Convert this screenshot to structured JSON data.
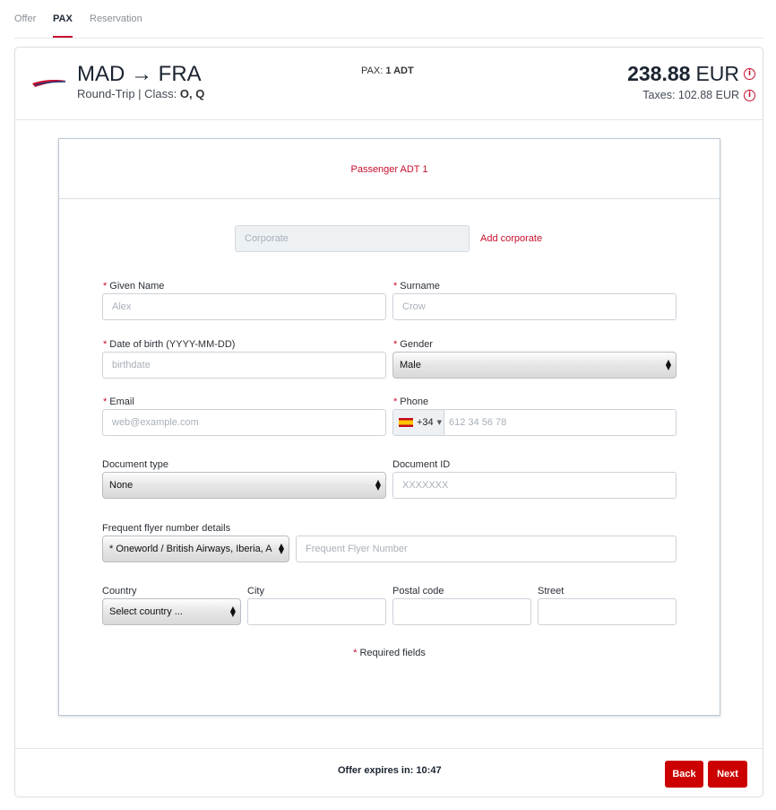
{
  "tabs": [
    {
      "label": "Offer"
    },
    {
      "label": "PAX"
    },
    {
      "label": "Reservation"
    }
  ],
  "header": {
    "route": "MAD → FRA",
    "trip_type": "Round-Trip | Class: ",
    "classes": "O, Q",
    "pax_label": "PAX: ",
    "pax_value": "1 ADT",
    "price_amount": "238.88",
    "price_currency": "EUR",
    "taxes": "Taxes: 102.88 EUR",
    "info_glyph": "i"
  },
  "form": {
    "title": "Passenger ADT 1",
    "corporate_placeholder": "Corporate",
    "add_corporate": "Add corporate",
    "required_marker": "*",
    "given_name": {
      "label": "Given Name",
      "placeholder": "Alex"
    },
    "surname": {
      "label": "Surname",
      "placeholder": "Crow"
    },
    "dob": {
      "label": "Date of birth (YYYY-MM-DD)",
      "placeholder": "birthdate"
    },
    "gender": {
      "label": "Gender",
      "value": "Male"
    },
    "email": {
      "label": "Email",
      "placeholder": "web@example.com"
    },
    "phone": {
      "label": "Phone",
      "prefix": "+34",
      "placeholder": "612 34 56 78",
      "flag": "spain-flag-icon"
    },
    "document_type": {
      "label": "Document type",
      "value": "None"
    },
    "document_id": {
      "label": "Document ID",
      "placeholder": "XXXXXXX"
    },
    "frequent_flyer": {
      "label": "Frequent flyer number details",
      "program": "* Oneworld / British Airways, Iberia, A",
      "placeholder": "Frequent Flyer Number"
    },
    "country": {
      "label": "Country",
      "value": "Select country ..."
    },
    "city": {
      "label": "City",
      "value": ""
    },
    "postal_code": {
      "label": "Postal code",
      "value": ""
    },
    "street": {
      "label": "Street",
      "value": ""
    },
    "required_note": "Required fields"
  },
  "footer": {
    "expires_label": "Offer expires in: ",
    "expires_value": "10:47",
    "back": "Back",
    "next": "Next"
  },
  "colors": {
    "accent": "#c8102e",
    "button": "#cc0000",
    "text_dark": "#1b2430"
  },
  "icons": [
    "airline-logo-icon",
    "info-icon",
    "select-arrows-icon",
    "spain-flag-icon"
  ]
}
